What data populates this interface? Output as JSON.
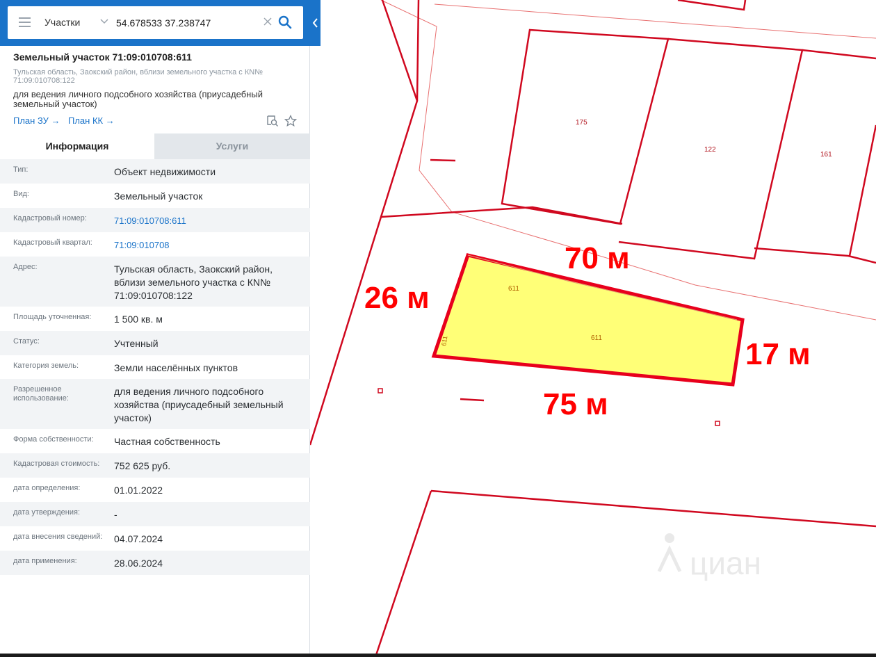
{
  "search": {
    "layer": "Участки",
    "query": "54.678533 37.238747"
  },
  "object": {
    "title": "Земельный участок 71:09:010708:611",
    "address": "Тульская область, Заокский район, вблизи земельного участка с КN№ 71:09:010708:122",
    "purpose": "для ведения личного подсобного хозяйства (приусадебный земельный участок)",
    "link_plan_zu": "План ЗУ →",
    "link_plan_kk": "План КК →"
  },
  "tabs": {
    "info": "Информация",
    "services": "Услуги"
  },
  "rows": [
    {
      "label": "Тип:",
      "value": "Объект недвижимости"
    },
    {
      "label": "Вид:",
      "value": "Земельный участок"
    },
    {
      "label": "Кадастровый номер:",
      "value": "71:09:010708:611"
    },
    {
      "label": "Кадастровый квартал:",
      "value": "71:09:010708"
    },
    {
      "label": "Адрес:",
      "value": "Тульская область, Заокский район, вблизи земельного участка с КN№ 71:09:010708:122"
    },
    {
      "label": "Площадь уточненная:",
      "value": "1 500 кв. м"
    },
    {
      "label": "Статус:",
      "value": "Учтенный"
    },
    {
      "label": "Категория земель:",
      "value": "Земли населённых пунктов"
    },
    {
      "label": "Разрешенное использование:",
      "value": "для ведения личного подсобного хозяйства (приусадебный земельный участок)"
    },
    {
      "label": "Форма собственности:",
      "value": "Частная собственность"
    },
    {
      "label": "Кадастровая стоимость:",
      "value": "752 625 руб."
    },
    {
      "label": "дата определения:",
      "value": "01.01.2022"
    },
    {
      "label": "дата утверждения:",
      "value": "-"
    },
    {
      "label": "дата внесения сведений:",
      "value": "04.07.2024"
    },
    {
      "label": "дата применения:",
      "value": "28.06.2024"
    }
  ],
  "map": {
    "parcel_labels": {
      "p175": "175",
      "p122": "122",
      "p161": "161",
      "p611": "611"
    },
    "dimensions": {
      "top": "70 м",
      "left": "26 м",
      "right": "17 м",
      "bottom": "75 м"
    },
    "watermark": "циан",
    "colors": {
      "boundary": "#e0001b",
      "parcel_fill": "#ffff77",
      "accent": "#1a73c9",
      "annotation": "#ff0000"
    }
  }
}
